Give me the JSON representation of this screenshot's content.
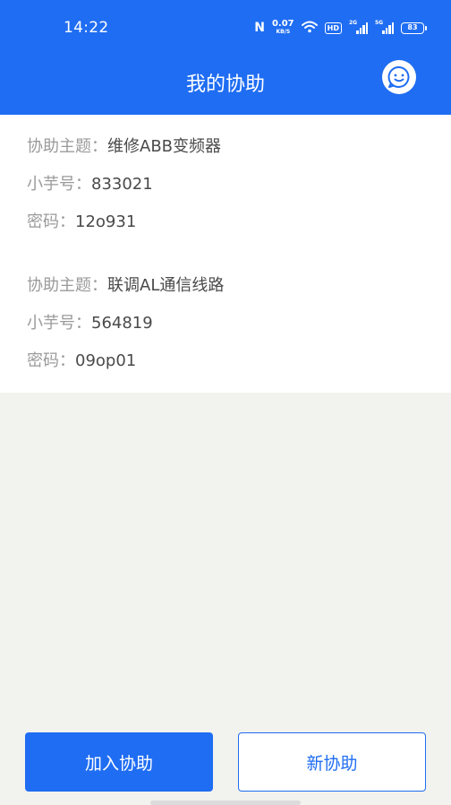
{
  "status_bar": {
    "time": "14:22",
    "nfc": "N",
    "net_speed_value": "0.07",
    "net_speed_unit": "KB/S",
    "hd_badge": "HD",
    "signal_gen_1": "2G",
    "signal_gen_2": "5G",
    "battery": "83",
    "icons": [
      "nfc-icon",
      "wifi-icon",
      "hd-icon",
      "signal-icon",
      "signal-icon",
      "battery-icon"
    ]
  },
  "app_bar": {
    "title": "我的协助",
    "chat_icon": "smiley-chat-icon"
  },
  "entries": [
    {
      "topic_label": "协助主题：",
      "topic": "维修ABB变频器",
      "code_label": "小芋号：",
      "code": "833021",
      "password_label": "密码：",
      "password": "12o931"
    },
    {
      "topic_label": "协助主题：",
      "topic": "联调AL通信线路",
      "code_label": "小芋号：",
      "code": "564819",
      "password_label": "密码：",
      "password": "09op01"
    }
  ],
  "actions": {
    "join_label": "加入协助",
    "new_label": "新协助"
  },
  "colors": {
    "primary": "#1f6df2",
    "background": "#f2f2ef",
    "label_text": "#9a9a9a",
    "value_text": "#4a4a4a"
  }
}
